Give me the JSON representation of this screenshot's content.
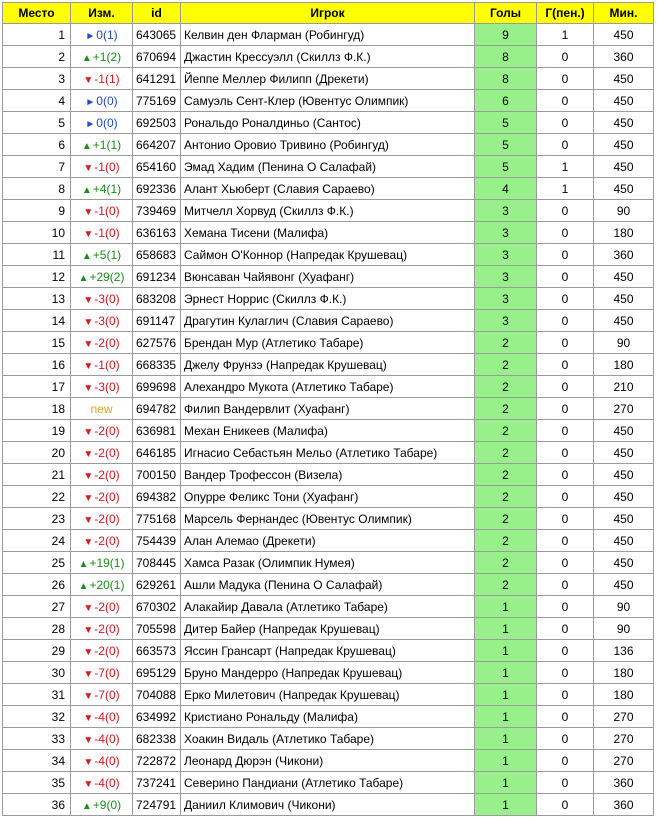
{
  "headers": {
    "rank": "Место",
    "change": "Изм.",
    "id": "id",
    "player": "Игрок",
    "goals": "Голы",
    "pen": "Г(пен.)",
    "mins": "Мин."
  },
  "colors": {
    "header_bg": "#ffff00",
    "goals_bg": "#98f08b",
    "up": "#1a8f1a",
    "down": "#e0141e",
    "same": "#1f49d6",
    "new": "#e6a21c"
  },
  "icons": {
    "up": "▲",
    "down": "▼",
    "same": "►"
  },
  "rows": [
    {
      "rank": "1",
      "dir": "same",
      "change": "0(1)",
      "id": "643065",
      "player": "Келвин ден Фларман (Робингуд)",
      "goals": "9",
      "pen": "1",
      "mins": "450"
    },
    {
      "rank": "2",
      "dir": "up",
      "change": "+1(2)",
      "id": "670694",
      "player": "Джастин Крессуэлл (Скиллз Ф.К.)",
      "goals": "8",
      "pen": "0",
      "mins": "360"
    },
    {
      "rank": "3",
      "dir": "down",
      "change": "-1(1)",
      "id": "641291",
      "player": "Йеппе Меллер Филипп (Дрекети)",
      "goals": "8",
      "pen": "0",
      "mins": "450"
    },
    {
      "rank": "4",
      "dir": "same",
      "change": "0(0)",
      "id": "775169",
      "player": "Самуэль Сент-Клер (Ювентус Олимпик)",
      "goals": "6",
      "pen": "0",
      "mins": "450"
    },
    {
      "rank": "5",
      "dir": "same",
      "change": "0(0)",
      "id": "692503",
      "player": "Рональдо Роналдиньо (Сантос)",
      "goals": "5",
      "pen": "0",
      "mins": "450"
    },
    {
      "rank": "6",
      "dir": "up",
      "change": "+1(1)",
      "id": "664207",
      "player": "Антонио Оровио Тривино (Робингуд)",
      "goals": "5",
      "pen": "0",
      "mins": "450"
    },
    {
      "rank": "7",
      "dir": "down",
      "change": "-1(0)",
      "id": "654160",
      "player": "Эмад Хадим (Пенина О Салафай)",
      "goals": "5",
      "pen": "1",
      "mins": "450"
    },
    {
      "rank": "8",
      "dir": "up",
      "change": "+4(1)",
      "id": "692336",
      "player": "Алант Хьюберт (Славия Сараево)",
      "goals": "4",
      "pen": "1",
      "mins": "450"
    },
    {
      "rank": "9",
      "dir": "down",
      "change": "-1(0)",
      "id": "739469",
      "player": "Митчелл Хорвуд (Скиллз Ф.К.)",
      "goals": "3",
      "pen": "0",
      "mins": "90"
    },
    {
      "rank": "10",
      "dir": "down",
      "change": "-1(0)",
      "id": "636163",
      "player": "Хемана Тисени (Малифа)",
      "goals": "3",
      "pen": "0",
      "mins": "180"
    },
    {
      "rank": "11",
      "dir": "up",
      "change": "+5(1)",
      "id": "658683",
      "player": "Саймон О'Коннор (Напредак Крушевац)",
      "goals": "3",
      "pen": "0",
      "mins": "360"
    },
    {
      "rank": "12",
      "dir": "up",
      "change": "+29(2)",
      "id": "691234",
      "player": "Вюнсаван Чайявонг (Хуафанг)",
      "goals": "3",
      "pen": "0",
      "mins": "450"
    },
    {
      "rank": "13",
      "dir": "down",
      "change": "-3(0)",
      "id": "683208",
      "player": "Эрнест Норрис (Скиллз Ф.К.)",
      "goals": "3",
      "pen": "0",
      "mins": "450"
    },
    {
      "rank": "14",
      "dir": "down",
      "change": "-3(0)",
      "id": "691147",
      "player": "Драгутин Кулаглич (Славия Сараево)",
      "goals": "3",
      "pen": "0",
      "mins": "450"
    },
    {
      "rank": "15",
      "dir": "down",
      "change": "-2(0)",
      "id": "627576",
      "player": "Брендан Мур (Атлетико Табаре)",
      "goals": "2",
      "pen": "0",
      "mins": "90"
    },
    {
      "rank": "16",
      "dir": "down",
      "change": "-1(0)",
      "id": "668335",
      "player": "Джелу Фрунзэ (Напредак Крушевац)",
      "goals": "2",
      "pen": "0",
      "mins": "180"
    },
    {
      "rank": "17",
      "dir": "down",
      "change": "-3(0)",
      "id": "699698",
      "player": "Алехандро Мукота (Атлетико Табаре)",
      "goals": "2",
      "pen": "0",
      "mins": "210"
    },
    {
      "rank": "18",
      "dir": "new",
      "change": "new",
      "id": "694782",
      "player": "Филип Вандервлит (Хуафанг)",
      "goals": "2",
      "pen": "0",
      "mins": "270"
    },
    {
      "rank": "19",
      "dir": "down",
      "change": "-2(0)",
      "id": "636981",
      "player": "Механ Еникеев (Малифа)",
      "goals": "2",
      "pen": "0",
      "mins": "450"
    },
    {
      "rank": "20",
      "dir": "down",
      "change": "-2(0)",
      "id": "646185",
      "player": "Игнасио Себастьян Мельо (Атлетико Табаре)",
      "goals": "2",
      "pen": "0",
      "mins": "450"
    },
    {
      "rank": "21",
      "dir": "down",
      "change": "-2(0)",
      "id": "700150",
      "player": "Вандер Трофессон (Визела)",
      "goals": "2",
      "pen": "0",
      "mins": "450"
    },
    {
      "rank": "22",
      "dir": "down",
      "change": "-2(0)",
      "id": "694382",
      "player": "Опурре Феликс Тони (Хуафанг)",
      "goals": "2",
      "pen": "0",
      "mins": "450"
    },
    {
      "rank": "23",
      "dir": "down",
      "change": "-2(0)",
      "id": "775168",
      "player": "Марсель Фернандес (Ювентус Олимпик)",
      "goals": "2",
      "pen": "0",
      "mins": "450"
    },
    {
      "rank": "24",
      "dir": "down",
      "change": "-2(0)",
      "id": "754439",
      "player": "Алан Алемао (Дрекети)",
      "goals": "2",
      "pen": "0",
      "mins": "450"
    },
    {
      "rank": "25",
      "dir": "up",
      "change": "+19(1)",
      "id": "708445",
      "player": "Хамса Разак (Олимпик Нумея)",
      "goals": "2",
      "pen": "0",
      "mins": "450"
    },
    {
      "rank": "26",
      "dir": "up",
      "change": "+20(1)",
      "id": "629261",
      "player": "Ашли Мадука (Пенина О Салафай)",
      "goals": "2",
      "pen": "0",
      "mins": "450"
    },
    {
      "rank": "27",
      "dir": "down",
      "change": "-2(0)",
      "id": "670302",
      "player": "Алакайир Давала (Атлетико Табаре)",
      "goals": "1",
      "pen": "0",
      "mins": "90"
    },
    {
      "rank": "28",
      "dir": "down",
      "change": "-2(0)",
      "id": "705598",
      "player": "Дитер Байер (Напредак Крушевац)",
      "goals": "1",
      "pen": "0",
      "mins": "90"
    },
    {
      "rank": "29",
      "dir": "down",
      "change": "-2(0)",
      "id": "663573",
      "player": "Яссин Грансарт (Напредак Крушевац)",
      "goals": "1",
      "pen": "0",
      "mins": "136"
    },
    {
      "rank": "30",
      "dir": "down",
      "change": "-7(0)",
      "id": "695129",
      "player": "Бруно Мандерро (Напредак Крушевац)",
      "goals": "1",
      "pen": "0",
      "mins": "180"
    },
    {
      "rank": "31",
      "dir": "down",
      "change": "-7(0)",
      "id": "704088",
      "player": "Ерко Милетович (Напредак Крушевац)",
      "goals": "1",
      "pen": "0",
      "mins": "180"
    },
    {
      "rank": "32",
      "dir": "down",
      "change": "-4(0)",
      "id": "634992",
      "player": "Кристиано Рональду (Малифа)",
      "goals": "1",
      "pen": "0",
      "mins": "270"
    },
    {
      "rank": "33",
      "dir": "down",
      "change": "-4(0)",
      "id": "682338",
      "player": "Хоакин Видаль (Атлетико Табаре)",
      "goals": "1",
      "pen": "0",
      "mins": "270"
    },
    {
      "rank": "34",
      "dir": "down",
      "change": "-4(0)",
      "id": "722872",
      "player": "Леонард Дюрэн (Чикони)",
      "goals": "1",
      "pen": "0",
      "mins": "270"
    },
    {
      "rank": "35",
      "dir": "down",
      "change": "-4(0)",
      "id": "737241",
      "player": "Северино Пандиани (Атлетико Табаре)",
      "goals": "1",
      "pen": "0",
      "mins": "360"
    },
    {
      "rank": "36",
      "dir": "up",
      "change": "+9(0)",
      "id": "724791",
      "player": "Даниил Климович (Чикони)",
      "goals": "1",
      "pen": "0",
      "mins": "360"
    }
  ]
}
